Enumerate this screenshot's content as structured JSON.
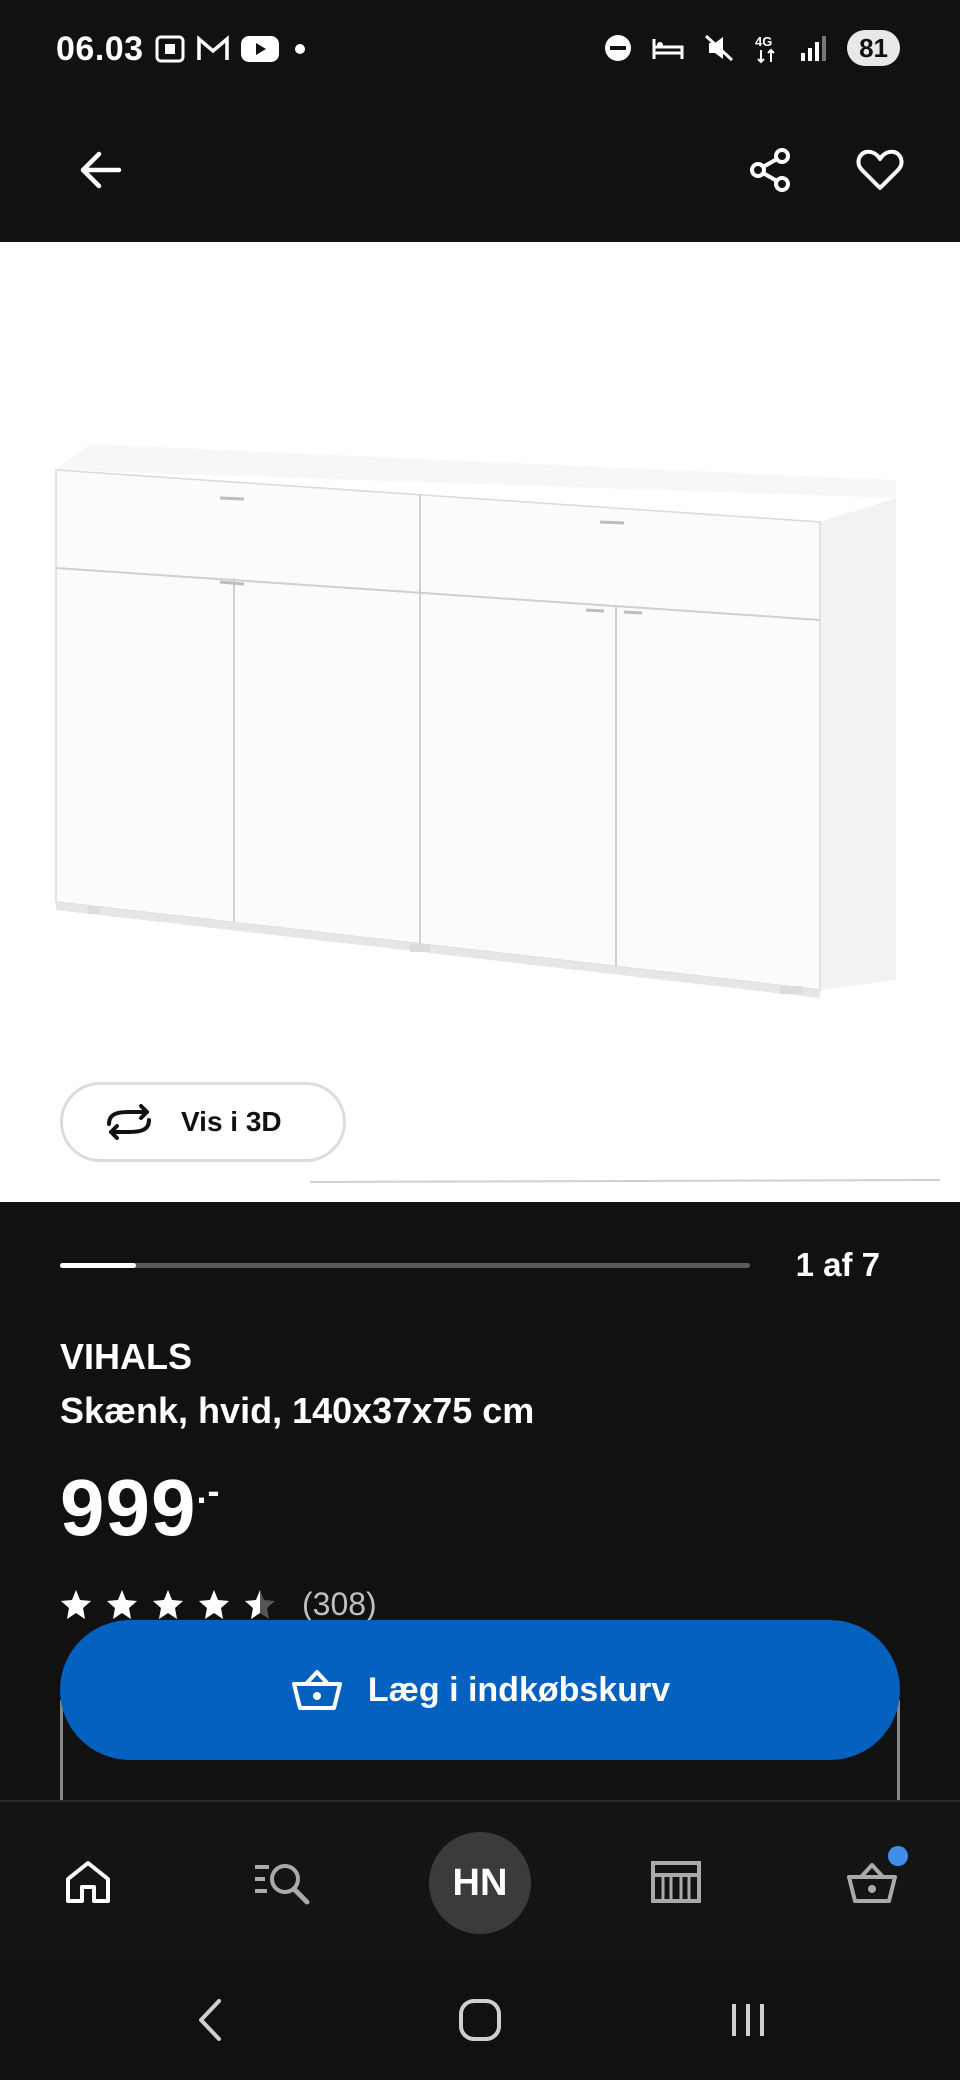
{
  "status_bar": {
    "time": "06.03",
    "battery": "81",
    "network": "4G"
  },
  "header": {
    "back_icon": "arrow-left-icon",
    "share_icon": "share-icon",
    "favorite_icon": "heart-icon"
  },
  "gallery": {
    "view_3d_label": "Vis i 3D",
    "progress_fraction": 0.11,
    "page_counter": "1 af 7"
  },
  "product": {
    "brand": "VIHALS",
    "description": "Skænk, hvid, 140x37x75 cm",
    "price": "999",
    "price_suffix": ".-",
    "rating_value": 4.5,
    "rating_count": "(308)"
  },
  "cta": {
    "add_to_cart_label": "Læg i indkøbskurv"
  },
  "bottom_nav": {
    "avatar_initials": "HN",
    "items": [
      "home-icon",
      "search-icon",
      "avatar",
      "store-icon",
      "cart-icon"
    ]
  },
  "colors": {
    "background": "#111111",
    "primary_blue": "#0461c0",
    "badge_blue": "#3f8fe8"
  }
}
